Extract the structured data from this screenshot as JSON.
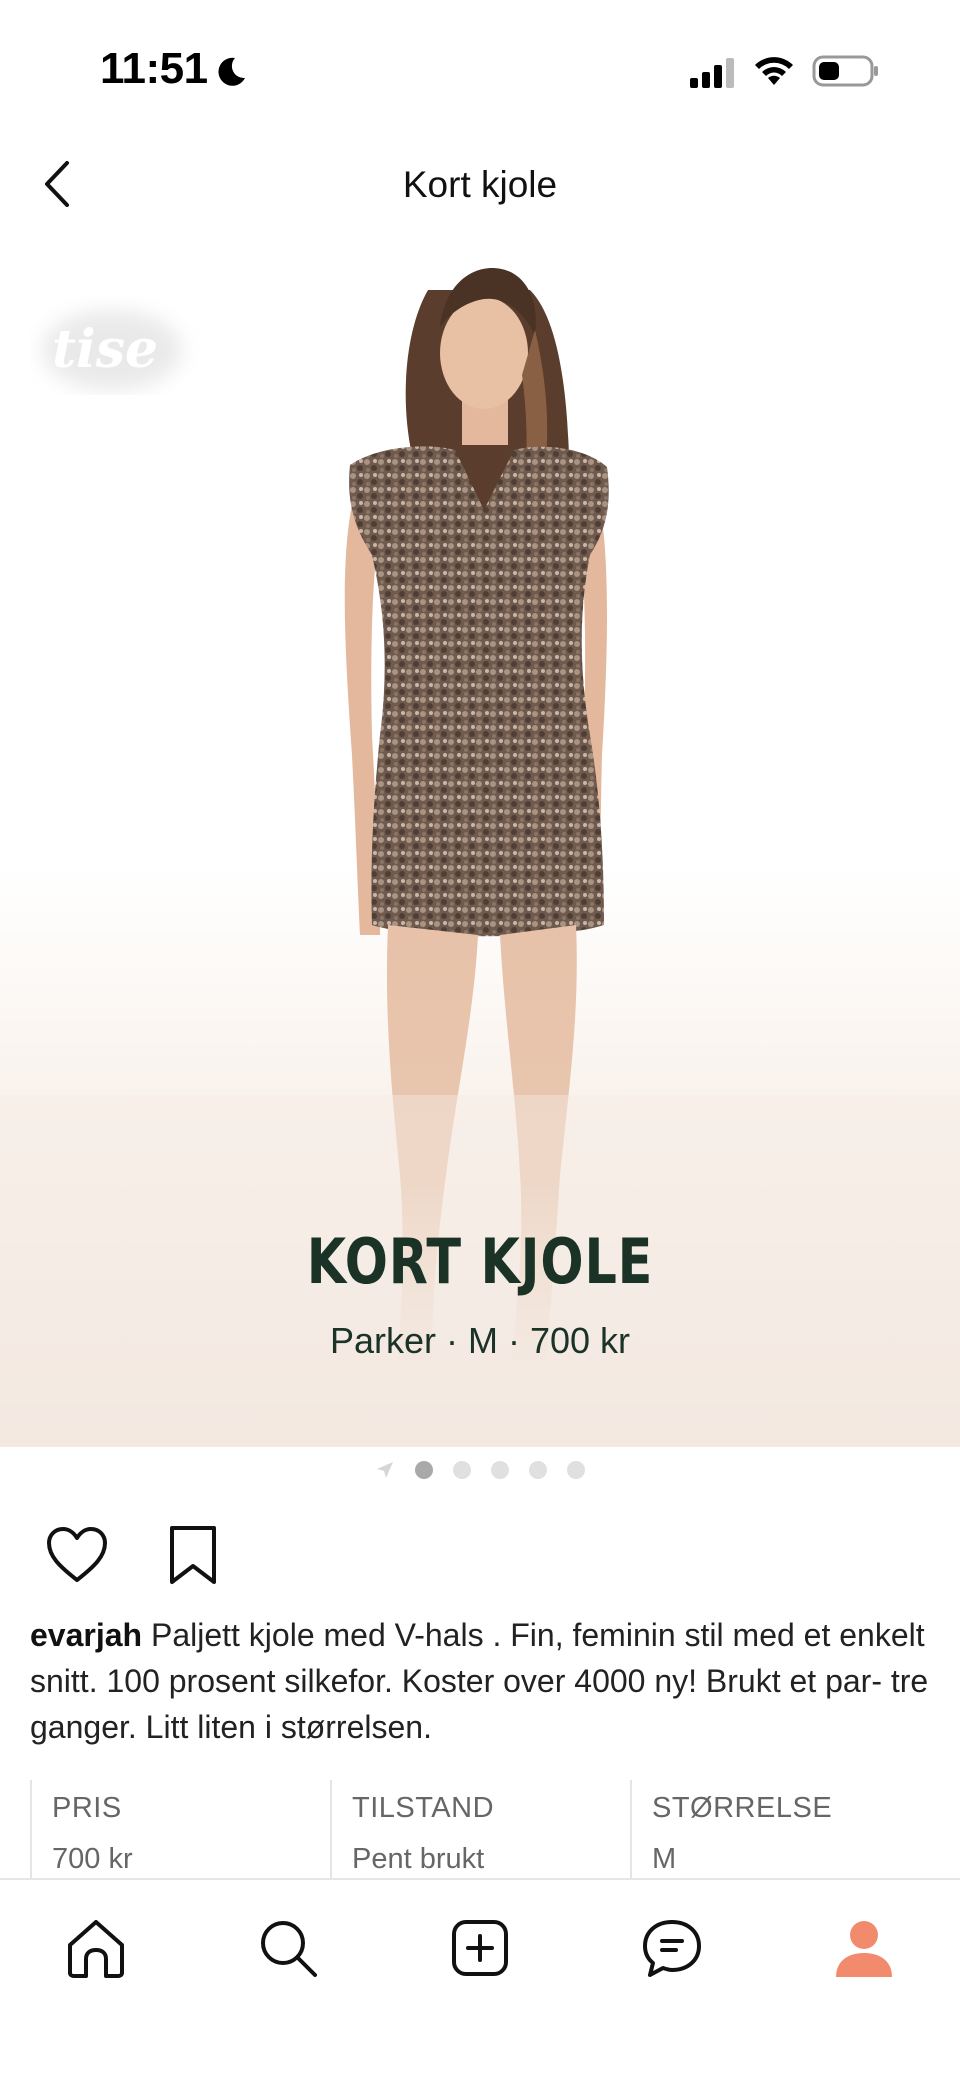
{
  "status_bar": {
    "time": "11:51",
    "icons": [
      "moon-icon",
      "signal-icon",
      "wifi-icon",
      "battery-icon"
    ]
  },
  "nav": {
    "title": "Kort kjole",
    "back_icon": "chevron-left-icon"
  },
  "hero": {
    "watermark": "tise",
    "title": "KORT KJOLE",
    "subtitle": "Parker · M · 700 kr",
    "title_color": "#1b3327"
  },
  "pager": {
    "count": 5,
    "active_index": 0
  },
  "actions": {
    "icons": [
      "heart-icon",
      "bookmark-icon"
    ]
  },
  "description": {
    "username": "evarjah",
    "text": " Paljett kjole med V-hals . Fin, feminin stil med et enkelt snitt. 100 prosent silkefor. Koster over 4000 ny! Brukt et par- tre ganger. Litt liten i størrelsen."
  },
  "info": [
    {
      "label": "PRIS",
      "value": "700 kr"
    },
    {
      "label": "TILSTAND",
      "value": "Pent brukt"
    },
    {
      "label": "STØRRELSE",
      "value": "M"
    }
  ],
  "tab_bar": {
    "tabs": [
      "home-icon",
      "search-icon",
      "add-icon",
      "messages-icon",
      "profile-icon"
    ],
    "accent": "#f28b6e"
  }
}
